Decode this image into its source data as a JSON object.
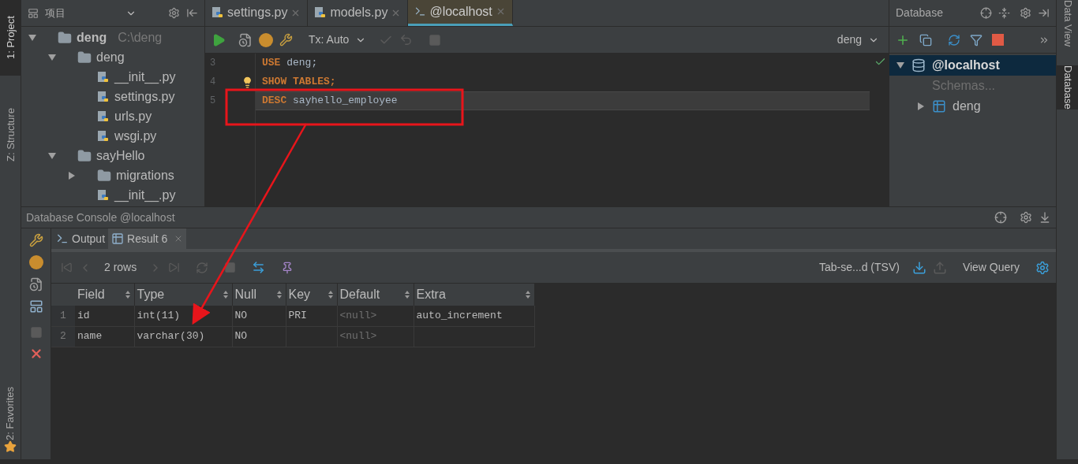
{
  "left_stripe": [
    {
      "label": "1: Project",
      "selected": true
    },
    {
      "label": "Z: Structure",
      "selected": false
    },
    {
      "label": "2: Favorites",
      "selected": false
    }
  ],
  "project_panel": {
    "title": "项目",
    "tree": [
      {
        "label": "deng",
        "path": "C:\\deng",
        "kind": "folder",
        "bold": true,
        "expanded": true,
        "children": [
          {
            "label": "deng",
            "kind": "folder",
            "expanded": true,
            "children": [
              {
                "label": "__init__.py",
                "kind": "python"
              },
              {
                "label": "settings.py",
                "kind": "python"
              },
              {
                "label": "urls.py",
                "kind": "python"
              },
              {
                "label": "wsgi.py",
                "kind": "python"
              }
            ]
          },
          {
            "label": "sayHello",
            "kind": "folder",
            "expanded": true,
            "children": [
              {
                "label": "migrations",
                "kind": "folder",
                "expanded": false
              },
              {
                "label": "__init__.py",
                "kind": "python"
              }
            ]
          }
        ]
      }
    ]
  },
  "editor_tabs": [
    {
      "label": "settings.py",
      "kind": "python",
      "selected": false
    },
    {
      "label": "models.py",
      "kind": "python",
      "selected": false
    },
    {
      "label": "@localhost",
      "kind": "console",
      "selected": true
    }
  ],
  "editor_toolbar": {
    "tx_mode": "Tx: Auto",
    "schema": "deng"
  },
  "editor": {
    "lines": [
      {
        "number": "3",
        "keyword": "USE",
        "rest": "deng;",
        "current": false
      },
      {
        "number": "4",
        "keyword": "SHOW TABLES;",
        "current": false,
        "hint": true
      },
      {
        "number": "5",
        "keyword": "DESC",
        "rest": "sayhello_employee",
        "current": true
      }
    ]
  },
  "database_panel": {
    "title": "Database",
    "tree": [
      {
        "label": "@localhost",
        "kind": "connection",
        "selected": true,
        "expanded": true,
        "children": [
          {
            "label": "Schemas...",
            "kind": "hint",
            "selected": false
          },
          {
            "label": "deng",
            "kind": "schema",
            "selected": false,
            "expanded": false
          }
        ]
      }
    ]
  },
  "right_stripe": [
    {
      "label": "Data View",
      "selected": false
    },
    {
      "label": "Database",
      "selected": true
    }
  ],
  "console": {
    "title": "Database Console @localhost",
    "tabs": [
      {
        "label": "Output",
        "kind": "output",
        "selected": false
      },
      {
        "label": "Result 6",
        "kind": "result",
        "selected": true
      }
    ],
    "row_count": "2 rows",
    "export_format": "Tab-se...d (TSV)",
    "view_query": "View Query",
    "table": {
      "columns": [
        "Field",
        "Type",
        "Null",
        "Key",
        "Default",
        "Extra"
      ],
      "rows": [
        {
          "number": "1",
          "cells": [
            {
              "text": "id",
              "kind": "value"
            },
            {
              "text": "int(11)",
              "kind": "value"
            },
            {
              "text": "NO",
              "kind": "value"
            },
            {
              "text": "PRI",
              "kind": "value"
            },
            {
              "text": "<null>",
              "kind": "null"
            },
            {
              "text": "auto_increment",
              "kind": "value"
            }
          ]
        },
        {
          "number": "2",
          "cells": [
            {
              "text": "name",
              "kind": "value"
            },
            {
              "text": "varchar(30)",
              "kind": "value"
            },
            {
              "text": "NO",
              "kind": "value"
            },
            {
              "kind": "empty"
            },
            {
              "text": "<null>",
              "kind": "null"
            },
            {
              "kind": "empty"
            }
          ]
        }
      ]
    }
  }
}
